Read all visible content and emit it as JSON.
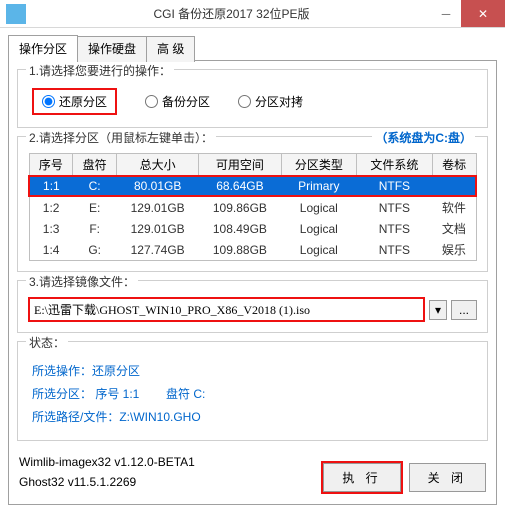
{
  "window": {
    "title": "CGI 备份还原2017 32位PE版"
  },
  "tabs": [
    "操作分区",
    "操作硬盘",
    "高 级"
  ],
  "section1": {
    "legend": "1.请选择您要进行的操作：",
    "opts": [
      "还原分区",
      "备份分区",
      "分区对拷"
    ]
  },
  "section2": {
    "legend": "2.请选择分区（用鼠标左键单击）：",
    "sysdisk": "（系统盘为C:盘）",
    "headers": [
      "序号",
      "盘符",
      "总大小",
      "可用空间",
      "分区类型",
      "文件系统",
      "卷标"
    ],
    "rows": [
      [
        "1:1",
        "C:",
        "80.01GB",
        "68.64GB",
        "Primary",
        "NTFS",
        ""
      ],
      [
        "1:2",
        "E:",
        "129.01GB",
        "109.86GB",
        "Logical",
        "NTFS",
        "软件"
      ],
      [
        "1:3",
        "F:",
        "129.01GB",
        "108.49GB",
        "Logical",
        "NTFS",
        "文档"
      ],
      [
        "1:4",
        "G:",
        "127.74GB",
        "109.88GB",
        "Logical",
        "NTFS",
        "娱乐"
      ]
    ]
  },
  "section3": {
    "legend": "3.请选择镜像文件：",
    "value": "E:\\迅雷下载\\GHOST_WIN10_PRO_X86_V2018 (1).iso"
  },
  "status": {
    "legend": "状态：",
    "l1": "所选操作：还原分区",
    "l2a": "所选分区： 序号 1:1",
    "l2b": "盘符 C:",
    "l3": "所选路径/文件：Z:\\WIN10.GHO"
  },
  "footer": {
    "v1": "Wimlib-imagex32 v1.12.0-BETA1",
    "v2": "Ghost32 v11.5.1.2269",
    "ok": "执 行",
    "cancel": "关 闭"
  }
}
